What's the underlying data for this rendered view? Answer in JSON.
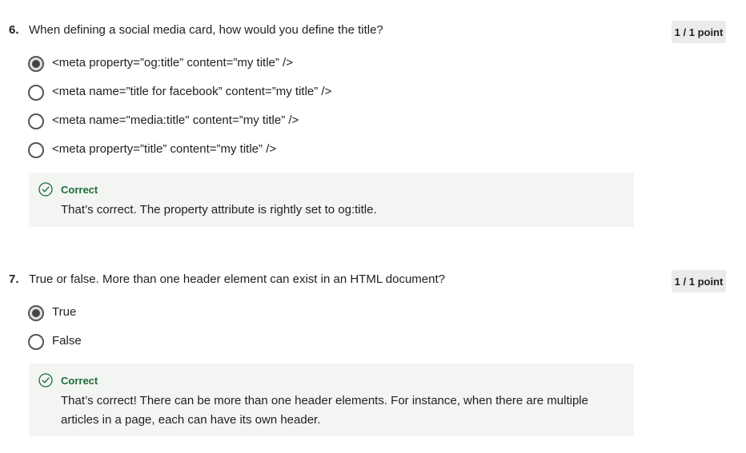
{
  "questions": [
    {
      "number": "6.",
      "text": "When defining a social media card, how would you define the title?",
      "points": "1 / 1 point",
      "options": [
        {
          "label": "<meta property=”og:title” content=”my title” />",
          "selected": true
        },
        {
          "label": "<meta name=”title for facebook” content=”my title” />",
          "selected": false
        },
        {
          "label": "<meta name=\"media:title\" content=”my title” />",
          "selected": false
        },
        {
          "label": "<meta property=”title” content=”my title” />",
          "selected": false
        }
      ],
      "feedback": {
        "status": "Correct",
        "text": "That’s correct. The property attribute is rightly set to og:title."
      }
    },
    {
      "number": "7.",
      "text": "True or false. More than one header element can exist in an HTML document?",
      "points": "1 / 1 point",
      "options": [
        {
          "label": "True",
          "selected": true
        },
        {
          "label": "False",
          "selected": false
        }
      ],
      "feedback": {
        "status": "Correct",
        "text": "That’s correct! There can be more than one header elements. For instance, when there are multiple articles in a page, each can have its own header."
      }
    }
  ],
  "colors": {
    "correct_green": "#1f6b3a",
    "feedback_bg": "#f2f5f2",
    "badge_bg": "#ebebeb"
  },
  "icons": {
    "feedback_icon": "check-circle-icon"
  }
}
